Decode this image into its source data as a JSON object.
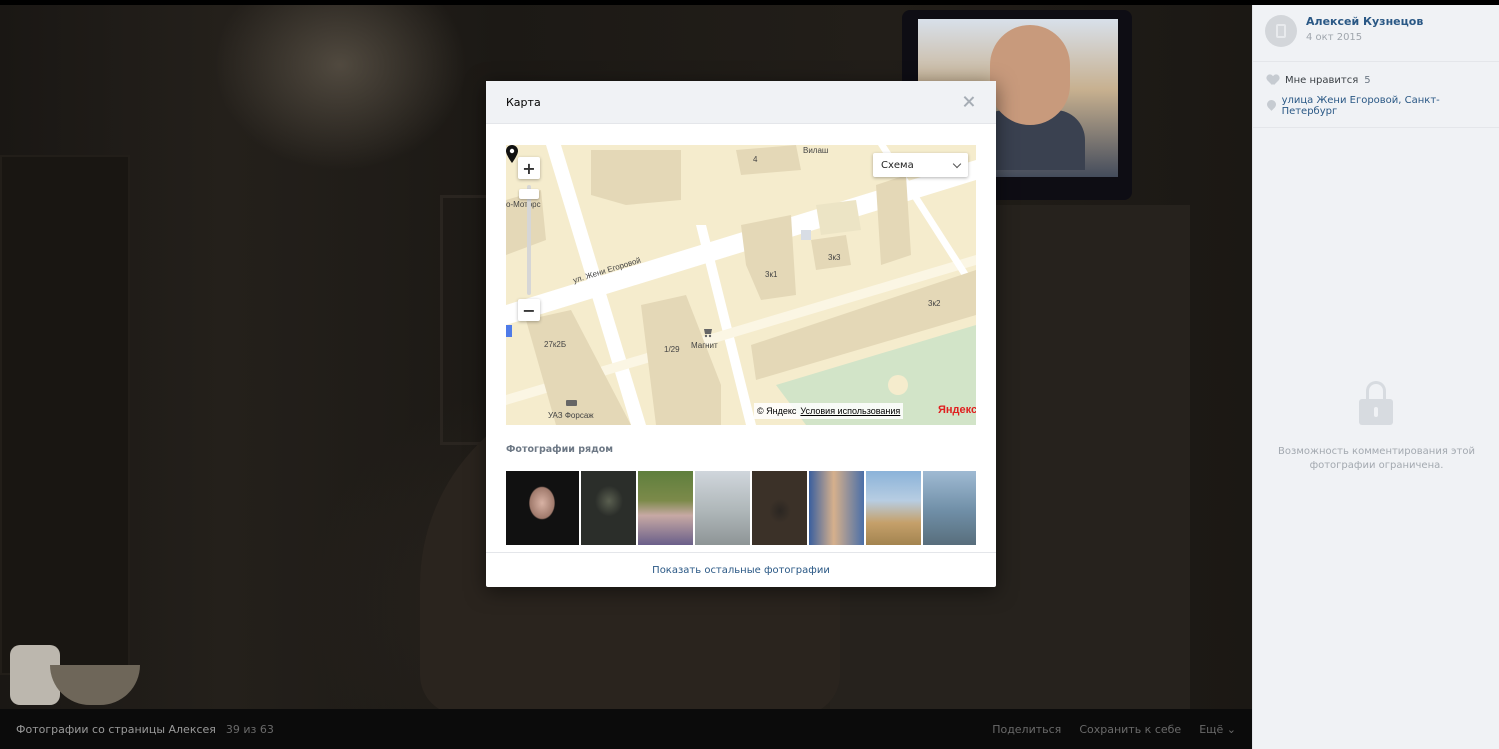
{
  "modal": {
    "title": "Карта",
    "map": {
      "type_selector": "Схема",
      "street_label": "ул. Жени Егоровой",
      "labels": [
        "Вилаш",
        "4",
        "о-Моторс",
        "3к1",
        "3к3",
        "3к2",
        "27к2Б",
        "1/29",
        "Магнит",
        "УАЗ Форсаж"
      ],
      "copyright": "© Яндекс",
      "terms_link": "Условия использования",
      "logo": "Яндекс"
    },
    "nearby_label": "Фотографии рядом",
    "show_more": "Показать остальные фотографии"
  },
  "sidebar": {
    "author_name": "Алексей Кузнецов",
    "date": "4 окт 2015",
    "like_label": "Мне нравится",
    "like_count": "5",
    "location": "улица Жени Егоровой, Санкт-Петербург",
    "comments_closed": "Возможность комментирования этой фотографии ограничена."
  },
  "bottom_bar": {
    "album_title": "Фотографии со страницы Алексея",
    "counter": "39 из 63",
    "actions": [
      "Поделиться",
      "Сохранить к себе",
      "Ещё ⌄"
    ]
  },
  "icons": {
    "close": "close-icon",
    "heart": "heart-icon",
    "location": "location-pin-icon",
    "lock": "lock-icon",
    "zoom_in": "plus-icon",
    "zoom_out": "minus-icon"
  },
  "colors": {
    "link": "#2a5885",
    "sidebar_bg": "#f0f2f5",
    "map_bg": "#f5eccd"
  }
}
